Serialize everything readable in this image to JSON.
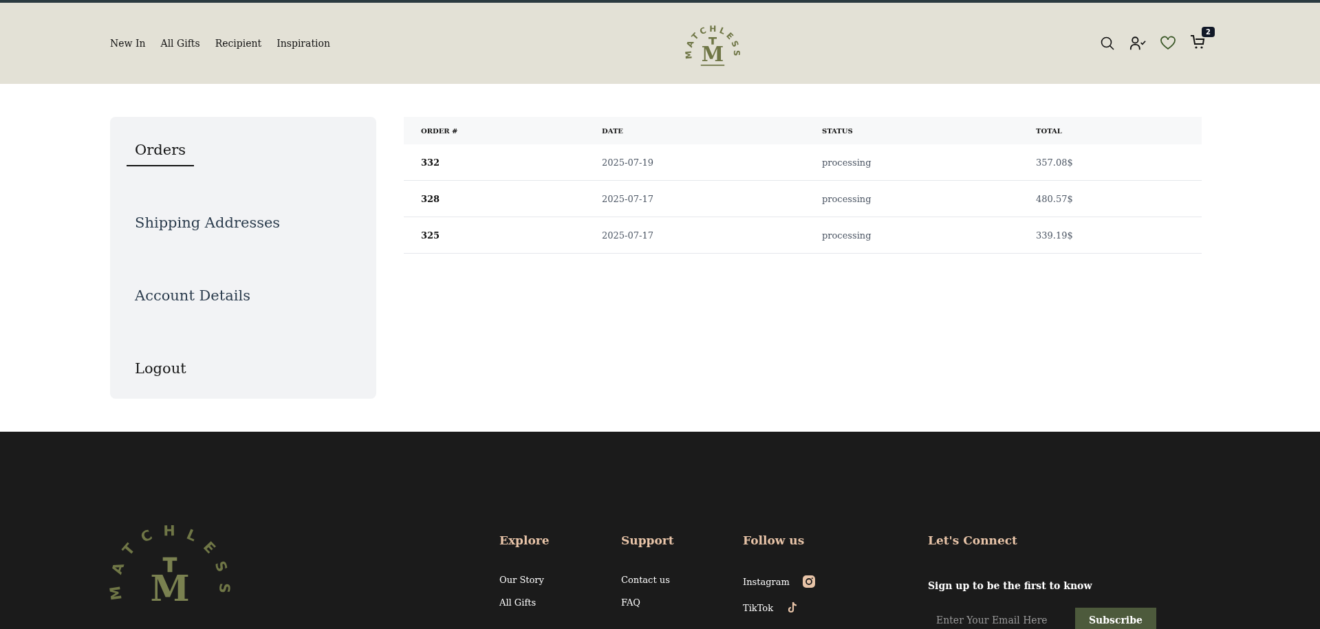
{
  "header": {
    "nav": [
      {
        "label": "New In"
      },
      {
        "label": "All Gifts"
      },
      {
        "label": "Recipient"
      },
      {
        "label": "Inspiration"
      }
    ],
    "logo": {
      "wordmark": "MATCHLESS",
      "monogram": "M"
    },
    "cart_count": "2"
  },
  "sidebar": {
    "items": [
      {
        "label": "Orders",
        "selected": true,
        "kind": "link"
      },
      {
        "label": "Shipping Addresses",
        "selected": false,
        "kind": "link"
      },
      {
        "label": "Account Details",
        "selected": false,
        "kind": "link"
      },
      {
        "label": "Logout",
        "selected": false,
        "kind": "action"
      }
    ]
  },
  "table": {
    "columns": [
      "ORDER #",
      "DATE",
      "STATUS",
      "TOTAL"
    ],
    "rows": [
      {
        "order": "332",
        "date": "2025-07-19",
        "status": "processing",
        "total": "357.08$"
      },
      {
        "order": "328",
        "date": "2025-07-17",
        "status": "processing",
        "total": "480.57$"
      },
      {
        "order": "325",
        "date": "2025-07-17",
        "status": "processing",
        "total": "339.19$"
      }
    ]
  },
  "footer": {
    "logo": {
      "wordmark": "MATCHLESS",
      "monogram": "M"
    },
    "columns": [
      {
        "heading": "Explore",
        "links": [
          {
            "label": "Our Story"
          },
          {
            "label": "All Gifts"
          }
        ]
      },
      {
        "heading": "Support",
        "links": [
          {
            "label": "Contact us"
          },
          {
            "label": "FAQ"
          }
        ]
      },
      {
        "heading": "Follow us",
        "kind": "social",
        "links": [
          {
            "label": "Instagram"
          },
          {
            "label": "TikTok"
          }
        ]
      }
    ],
    "newsletter": {
      "heading": "Let's Connect",
      "text": "Sign up to be the first to know",
      "placeholder": "Enter Your Email Here",
      "button": "Subscribe"
    }
  }
}
